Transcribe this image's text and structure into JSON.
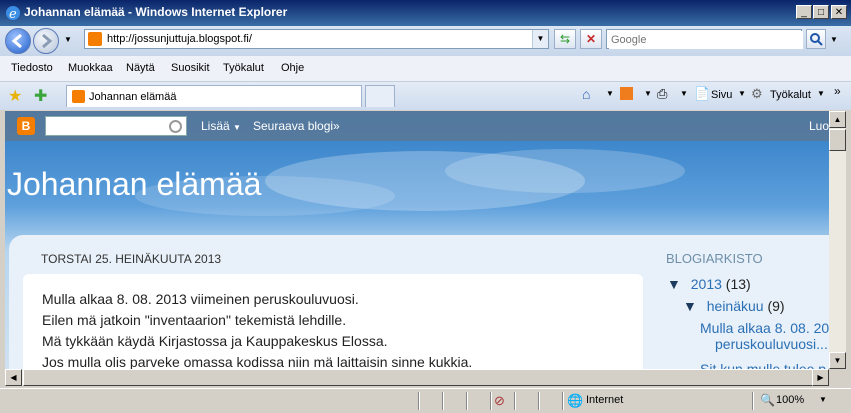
{
  "window": {
    "title": "Johannan elämää - Windows Internet Explorer",
    "controls": {
      "minimize": "_",
      "maximize": "□",
      "close": "✕"
    }
  },
  "address": {
    "url": "http://jossunjuttuja.blogspot.fi/"
  },
  "search": {
    "placeholder": "Google"
  },
  "menu": [
    "Tiedosto",
    "Muokkaa",
    "Näytä",
    "Suosikit",
    "Työkalut",
    "Ohje"
  ],
  "tab": {
    "label": "Johannan elämää"
  },
  "command_bar": {
    "page_label": "Sivu",
    "tools_label": "Työkalut"
  },
  "blogger_navbar": {
    "more_label": "Lisää",
    "next_blog_label": "Seuraava blogi»",
    "right_label": "Luo"
  },
  "blog": {
    "title": "Johannan elämää",
    "date_header": "TORSTAI 25. HEINÄKUUTA 2013",
    "post_lines": [
      "Mulla alkaa 8. 08. 2013 viimeinen peruskouluvuosi.",
      "Eilen mä jatkoin \"inventaarion\" tekemistä lehdille.",
      "Mä tykkään käydä Kirjastossa ja Kauppakeskus Elossa.",
      "Jos mulla olis parveke omassa kodissa niin mä laittaisin sinne kukkia."
    ]
  },
  "archive": {
    "heading": "BLOGIARKISTO",
    "year": "2013",
    "year_count": "(13)",
    "month": "heinäkuu",
    "month_count": "(9)",
    "post_link_1a": "Mulla alkaa 8. 08. 20",
    "post_link_1b": "peruskouluvuosi...",
    "post_link_2": "Sit kun mulle tulee p"
  },
  "status": {
    "zone": "Internet",
    "zoom": "100%"
  }
}
